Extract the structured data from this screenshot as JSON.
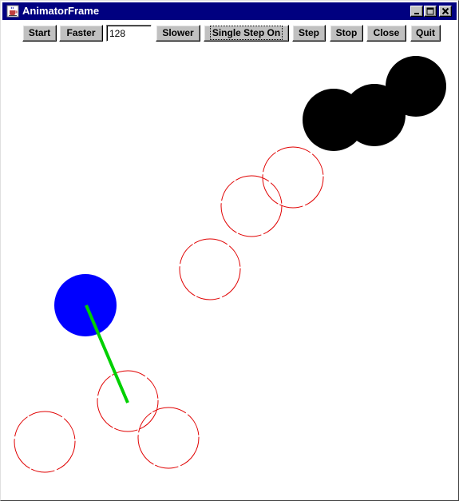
{
  "window": {
    "title": "AnimatorFrame",
    "title_icon": "java-cup-icon",
    "controls": {
      "minimize": "minimize-icon",
      "maximize": "maximize-icon",
      "close": "close-icon"
    }
  },
  "toolbar": {
    "start_label": "Start",
    "faster_label": "Faster",
    "speed_value": "128",
    "slower_label": "Slower",
    "single_step_label": "Single Step On",
    "step_label": "Step",
    "stop_label": "Stop",
    "close_label": "Close",
    "quit_label": "Quit"
  },
  "animation": {
    "colors": {
      "trail": "#e00000",
      "player": "#0000ff",
      "vector": "#00d000",
      "obstacle": "#000000",
      "background": "#ffffff"
    }
  }
}
